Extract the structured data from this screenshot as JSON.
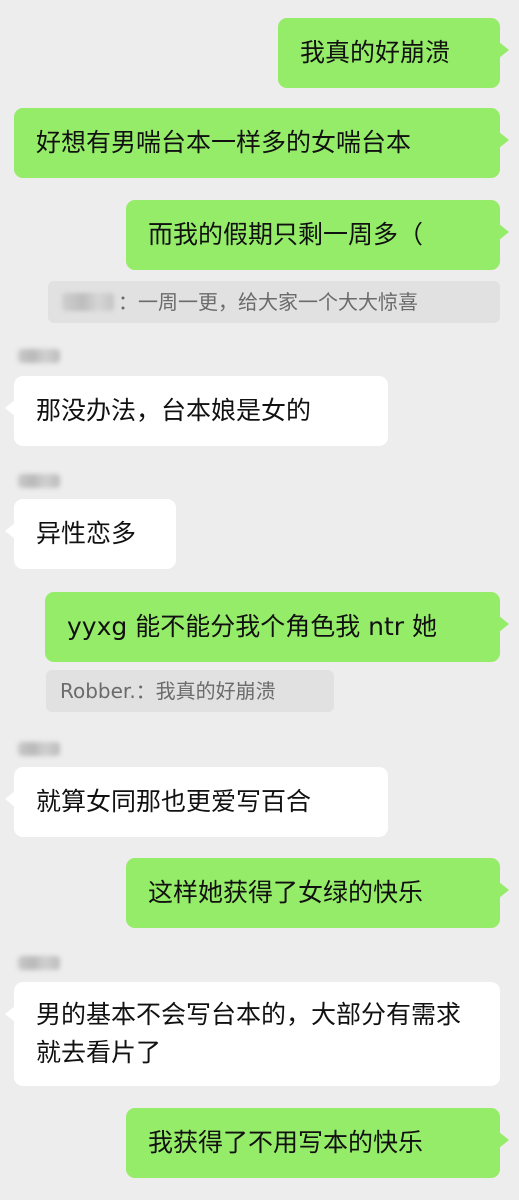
{
  "messages": {
    "m1": "我真的好崩溃",
    "m2": "好想有男喘台本一样多的女喘台本",
    "m3": "而我的假期只剩一周多（",
    "q1": "：一周一更，给大家一个大大惊喜",
    "m4": "那没办法，台本娘是女的",
    "m5": "异性恋多",
    "m6": "yyxg 能不能分我个角色我 ntr 她",
    "q2": "Robber.：我真的好崩溃",
    "m7": "就算女同那也更爱写百合",
    "m8": "这样她获得了女绿的快乐",
    "m9": "男的基本不会写台本的，大部分有需求就去看片了",
    "m10": "我获得了不用写本的快乐"
  },
  "colors": {
    "background": "#ededed",
    "outgoing_bubble": "#95ec69",
    "incoming_bubble": "#ffffff",
    "quote_background": "#e1e1e1",
    "quote_text": "#6b6b6b"
  }
}
